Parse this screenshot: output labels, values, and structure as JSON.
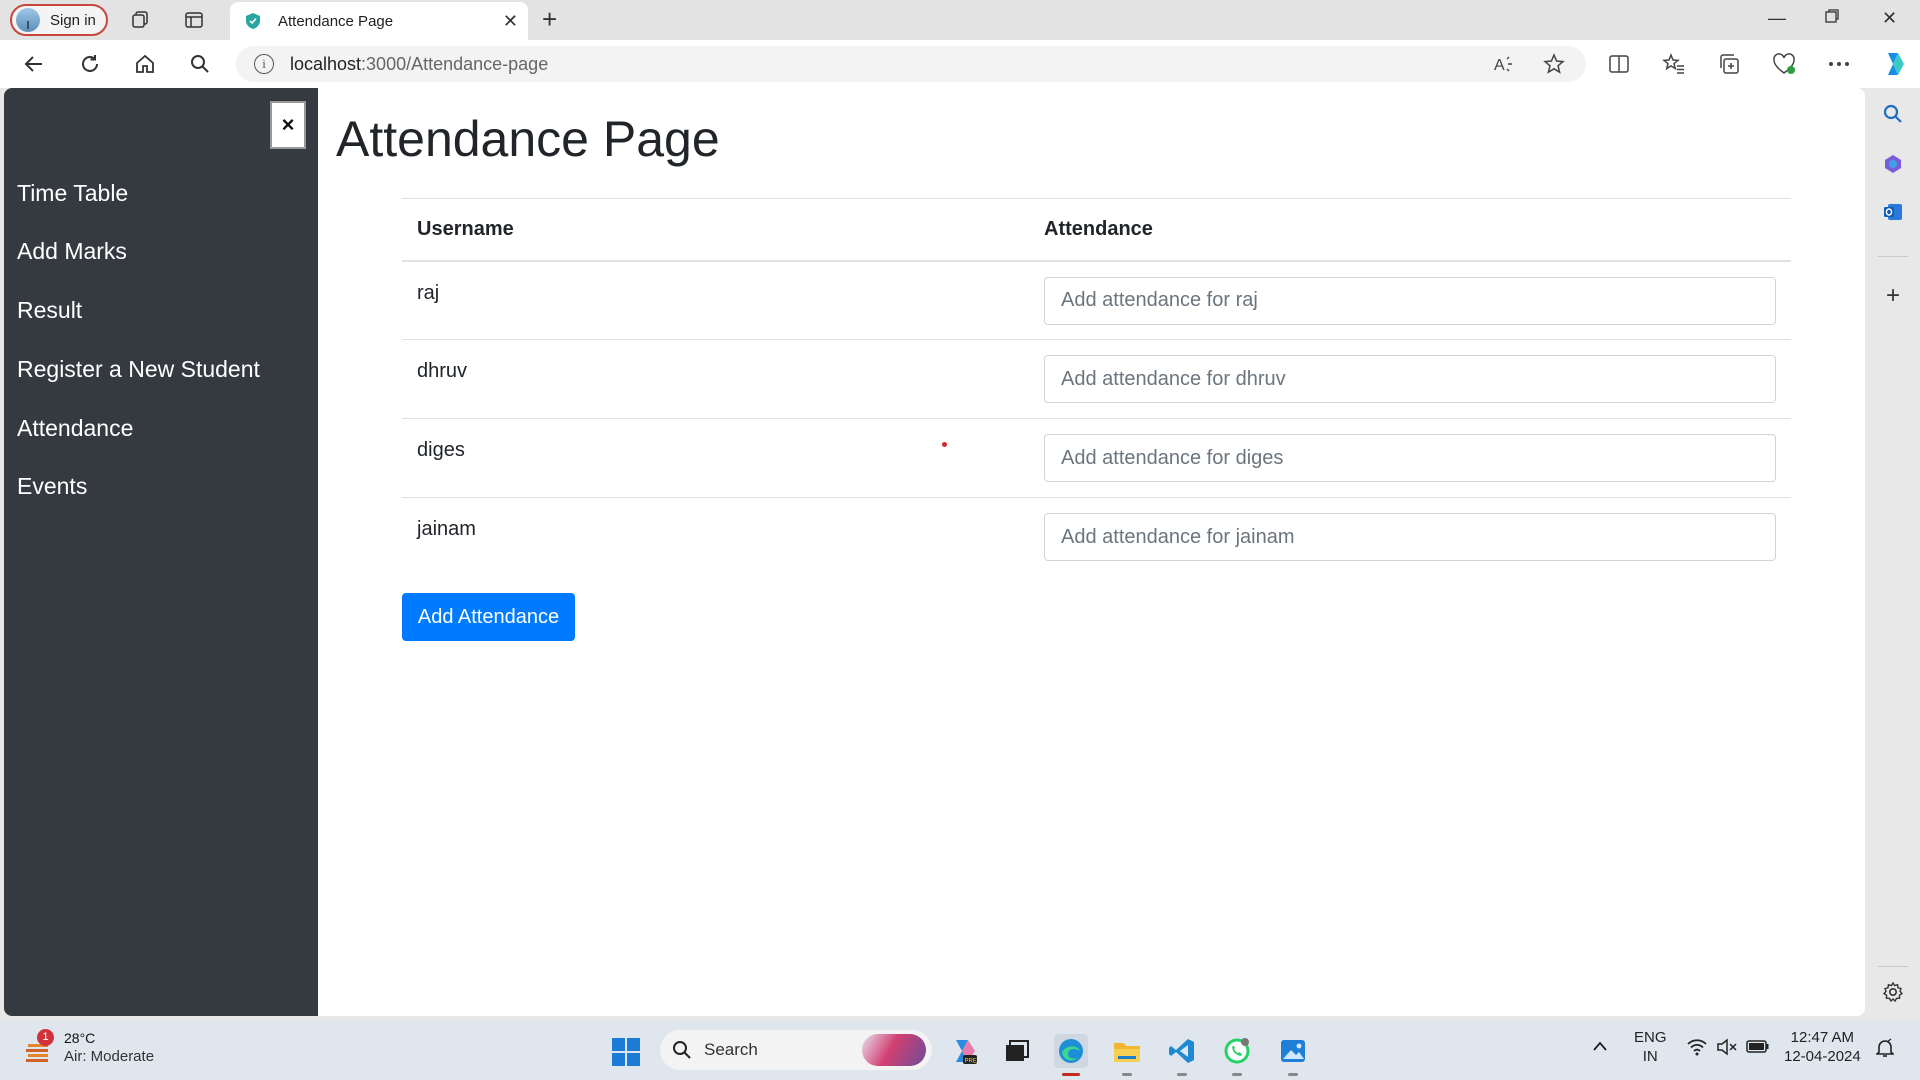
{
  "browser": {
    "signin_label": "Sign in",
    "tab_title": "Attendance Page",
    "url_host": "localhost",
    "url_path": ":3000/Attendance-page"
  },
  "sidebar": {
    "close_label": "×",
    "items": [
      {
        "label": "Time Table"
      },
      {
        "label": "Add Marks"
      },
      {
        "label": "Result"
      },
      {
        "label": "Register a New Student"
      },
      {
        "label": "Attendance"
      },
      {
        "label": "Events"
      }
    ]
  },
  "page": {
    "title": "Attendance Page",
    "table": {
      "headers": [
        "Username",
        "Attendance"
      ],
      "rows": [
        {
          "username": "raj",
          "placeholder": "Add attendance for raj"
        },
        {
          "username": "dhruv",
          "placeholder": "Add attendance for dhruv"
        },
        {
          "username": "diges",
          "placeholder": "Add attendance for diges"
        },
        {
          "username": "jainam",
          "placeholder": "Add attendance for jainam"
        }
      ]
    },
    "submit_label": "Add Attendance"
  },
  "taskbar": {
    "weather_temp": "28°C",
    "weather_desc": "Air: Moderate",
    "weather_badge": "1",
    "search_label": "Search",
    "lang_line1": "ENG",
    "lang_line2": "IN",
    "time": "12:47 AM",
    "date": "12-04-2024"
  },
  "colors": {
    "sidebar_bg": "#343a40",
    "primary_button": "#007bff",
    "signin_border": "#c9463d"
  }
}
